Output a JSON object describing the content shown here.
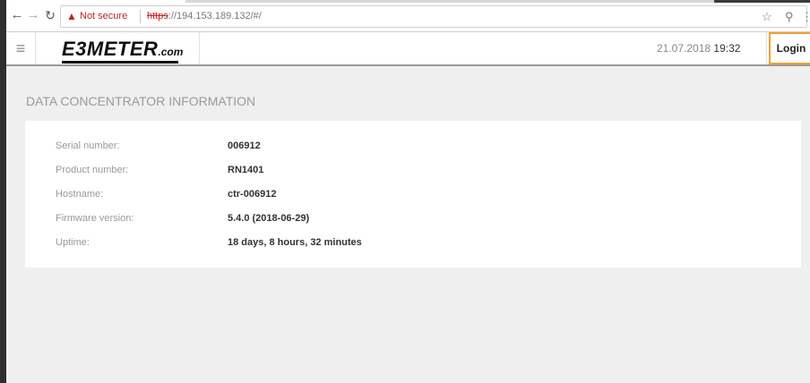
{
  "browser": {
    "security_label": "Not secure",
    "url_scheme": "https",
    "url_rest": "://194.153.189.132/#/",
    "icons": {
      "back": "arrow-left-icon",
      "forward": "arrow-right-icon",
      "reload": "reload-icon",
      "warning": "warning-triangle-icon",
      "star": "star-icon",
      "extension": "extension-icon",
      "menu": "kebab-menu-icon"
    }
  },
  "header": {
    "logo_main": "E3METER",
    "logo_suffix": ".com",
    "date": "21.07.2018",
    "time": "19:32",
    "login_label": "Login",
    "accent_color": "#f0a230"
  },
  "main": {
    "title": "DATA CONCENTRATOR INFORMATION",
    "rows": [
      {
        "label": "Serial number:",
        "value": "006912"
      },
      {
        "label": "Product number:",
        "value": "RN1401"
      },
      {
        "label": "Hostname:",
        "value": "ctr-006912"
      },
      {
        "label": "Firmware version:",
        "value": "5.4.0 (2018-06-29)"
      },
      {
        "label": "Uptime:",
        "value": "18 days, 8 hours, 32 minutes"
      }
    ]
  }
}
